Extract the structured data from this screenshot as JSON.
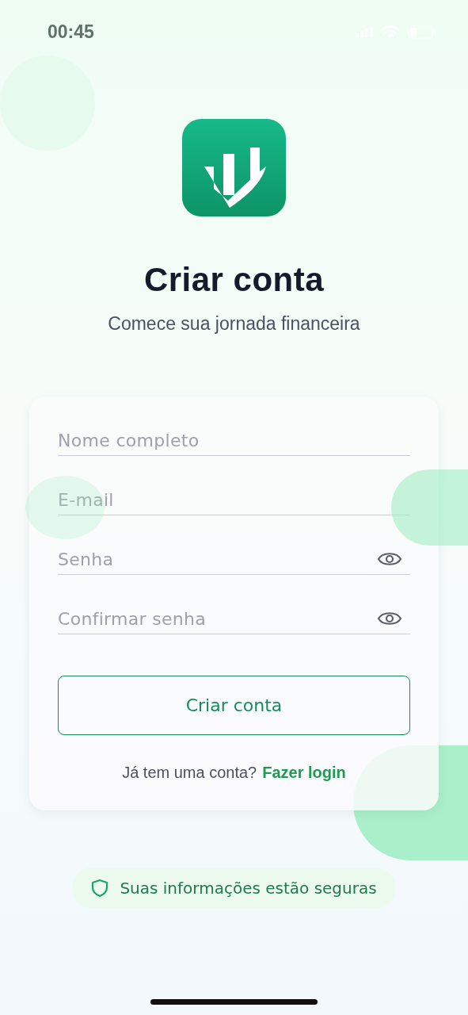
{
  "status_bar": {
    "time": "00:45"
  },
  "title": "Criar conta",
  "subtitle": "Comece sua jornada financeira",
  "form": {
    "fields": [
      {
        "placeholder": "Nome completo",
        "kind": "text"
      },
      {
        "placeholder": "E-mail",
        "kind": "text"
      },
      {
        "placeholder": "Senha",
        "kind": "password"
      },
      {
        "placeholder": "Confirmar senha",
        "kind": "password"
      }
    ],
    "submit_button": "Criar conta",
    "login_prompt": "Já tem uma conta?",
    "login_link": "Fazer login"
  },
  "security_badge": "Suas informações estão seguras"
}
